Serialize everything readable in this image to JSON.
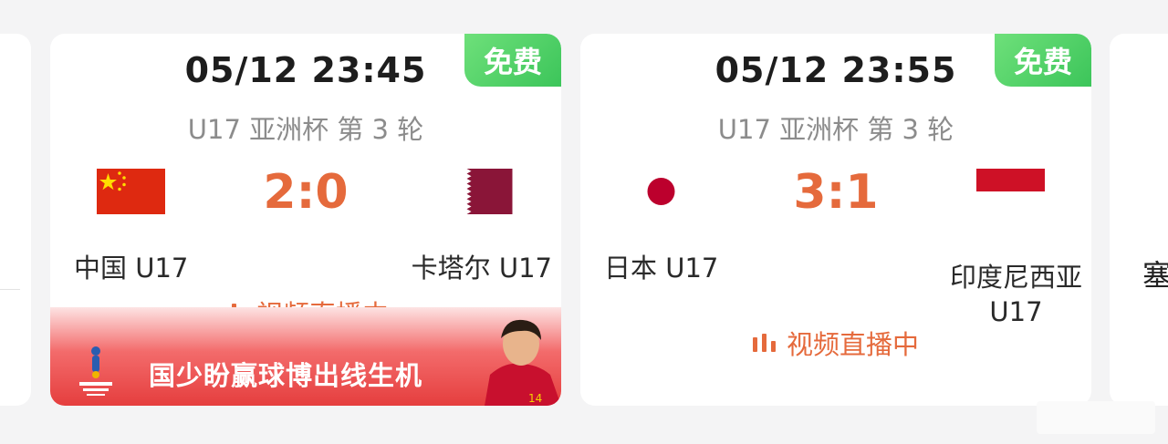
{
  "matches": [
    {
      "badge": "免费",
      "time": "05/12 23:45",
      "round": "U17 亚洲杯 第 3 轮",
      "score": "2:0",
      "home": "中国 U17",
      "away": "卡塔尔 U17",
      "live": "视频直播中",
      "promo": "国少盼赢球博出线生机"
    },
    {
      "badge": "免费",
      "time": "05/12 23:55",
      "round": "U17 亚洲杯 第 3 轮",
      "score": "3:1",
      "home": "日本 U17",
      "away_line1": "印度尼西亚",
      "away_line2": "U17",
      "live": "视频直播中"
    }
  ],
  "next_card_peek": "塞",
  "colors": {
    "accent": "#e56a3c",
    "badge": "#3cc55a",
    "promo": "#e53e3e"
  },
  "icons": [
    "china-flag-icon",
    "qatar-flag-icon",
    "japan-flag-icon",
    "indonesia-flag-icon",
    "live-bars-icon",
    "afc-u17-logo-icon"
  ]
}
